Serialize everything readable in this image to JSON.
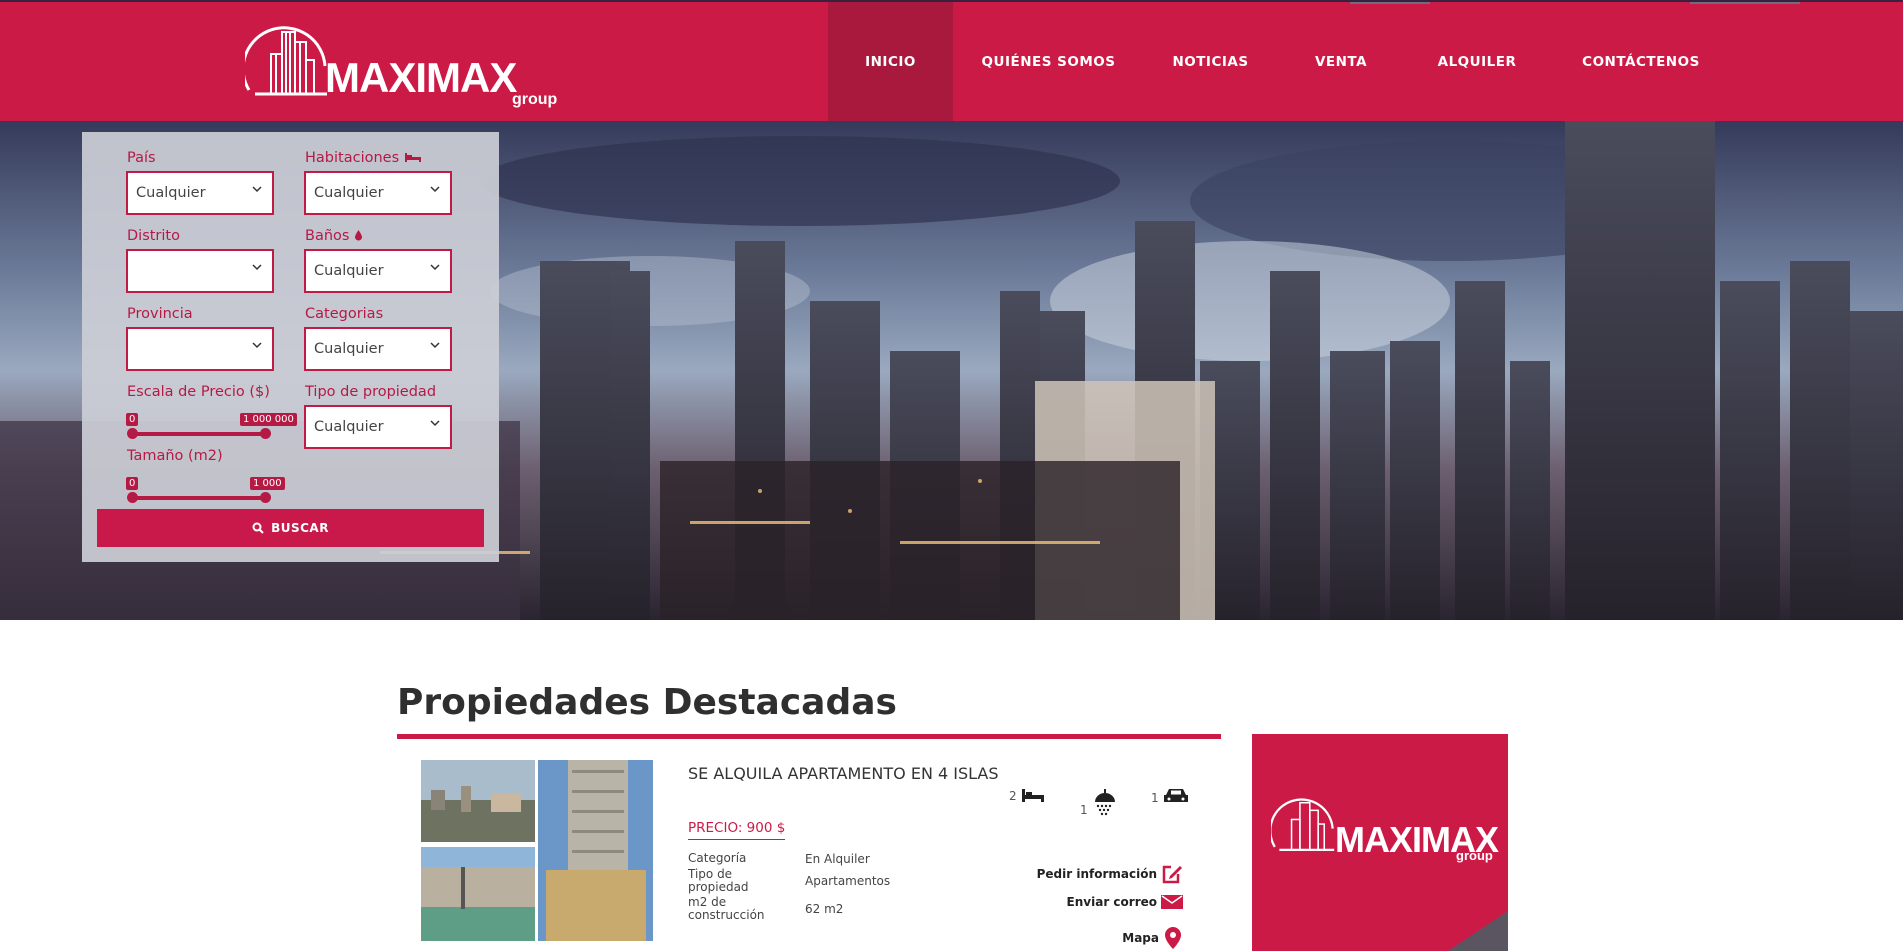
{
  "brand": {
    "name": "MAXIMAX",
    "sub": "group",
    "color": "#cc1a47"
  },
  "nav": {
    "items": [
      {
        "label": "INICIO",
        "active": true
      },
      {
        "label": "QUIÉNES SOMOS"
      },
      {
        "label": "NOTICIAS"
      },
      {
        "label": "VENTA"
      },
      {
        "label": "ALQUILER"
      },
      {
        "label": "CONTÁCTENOS"
      }
    ]
  },
  "search": {
    "pais": {
      "label": "País",
      "value": "Cualquier"
    },
    "habitaciones": {
      "label": "Habitaciones",
      "value": "Cualquier",
      "icon": "bed-icon"
    },
    "distrito": {
      "label": "Distrito",
      "value": ""
    },
    "banos": {
      "label": "Baños",
      "value": "Cualquier",
      "icon": "drop-icon"
    },
    "provincia": {
      "label": "Provincia",
      "value": ""
    },
    "categorias": {
      "label": "Categorias",
      "value": "Cualquier"
    },
    "precio": {
      "label": "Escala de Precio ($)",
      "min": "0",
      "max": "1 000 000"
    },
    "tipo": {
      "label": "Tipo de propiedad",
      "value": "Cualquier"
    },
    "tamano": {
      "label": "Tamaño (m2)",
      "min": "0",
      "max": "1 000"
    },
    "button": "BUSCAR"
  },
  "main": {
    "section_title": "Propiedades Destacadas",
    "property": {
      "title": "SE ALQUILA APARTAMENTO EN 4 ISLAS",
      "beds": "2",
      "baths": "1",
      "parking": "1",
      "price": "PRECIO: 900 $",
      "specs": [
        {
          "key": "Categoría",
          "value": "En Alquiler"
        },
        {
          "key": "Tipo de propiedad",
          "value": "Apartamentos"
        },
        {
          "key": "m2 de construcción",
          "value": "62 m2"
        }
      ],
      "actions": {
        "info": "Pedir información",
        "email": "Enviar correo",
        "map": "Mapa"
      }
    }
  },
  "ad": {
    "name": "MAXIMAX",
    "sub": "group"
  }
}
